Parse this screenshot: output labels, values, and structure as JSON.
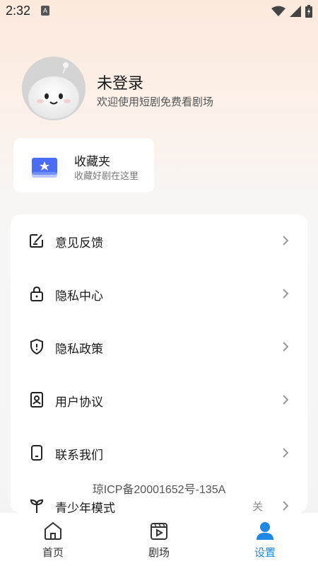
{
  "status_bar": {
    "time": "2:32",
    "app_icon_letter": "A"
  },
  "profile": {
    "name": "未登录",
    "subtitle": "欢迎使用短剧免费看剧场"
  },
  "favorites": {
    "title": "收藏夹",
    "subtitle": "收藏好剧在这里"
  },
  "settings": {
    "items": [
      {
        "label": "意见反馈",
        "icon": "feedback-icon"
      },
      {
        "label": "隐私中心",
        "icon": "lock-icon"
      },
      {
        "label": "隐私政策",
        "icon": "shield-icon"
      },
      {
        "label": "用户协议",
        "icon": "user-agreement-icon"
      },
      {
        "label": "联系我们",
        "icon": "phone-icon"
      },
      {
        "label": "青少年模式",
        "icon": "sprout-icon",
        "value": "关"
      }
    ]
  },
  "icp": "琼ICP备20001652号-135A",
  "bottom_nav": {
    "items": [
      {
        "label": "首页",
        "icon": "home-icon"
      },
      {
        "label": "剧场",
        "icon": "theater-icon"
      },
      {
        "label": "设置",
        "icon": "person-icon",
        "active": true
      }
    ]
  },
  "colors": {
    "accent": "#1e88e5",
    "favorite_icon": "#4a6cf7"
  }
}
